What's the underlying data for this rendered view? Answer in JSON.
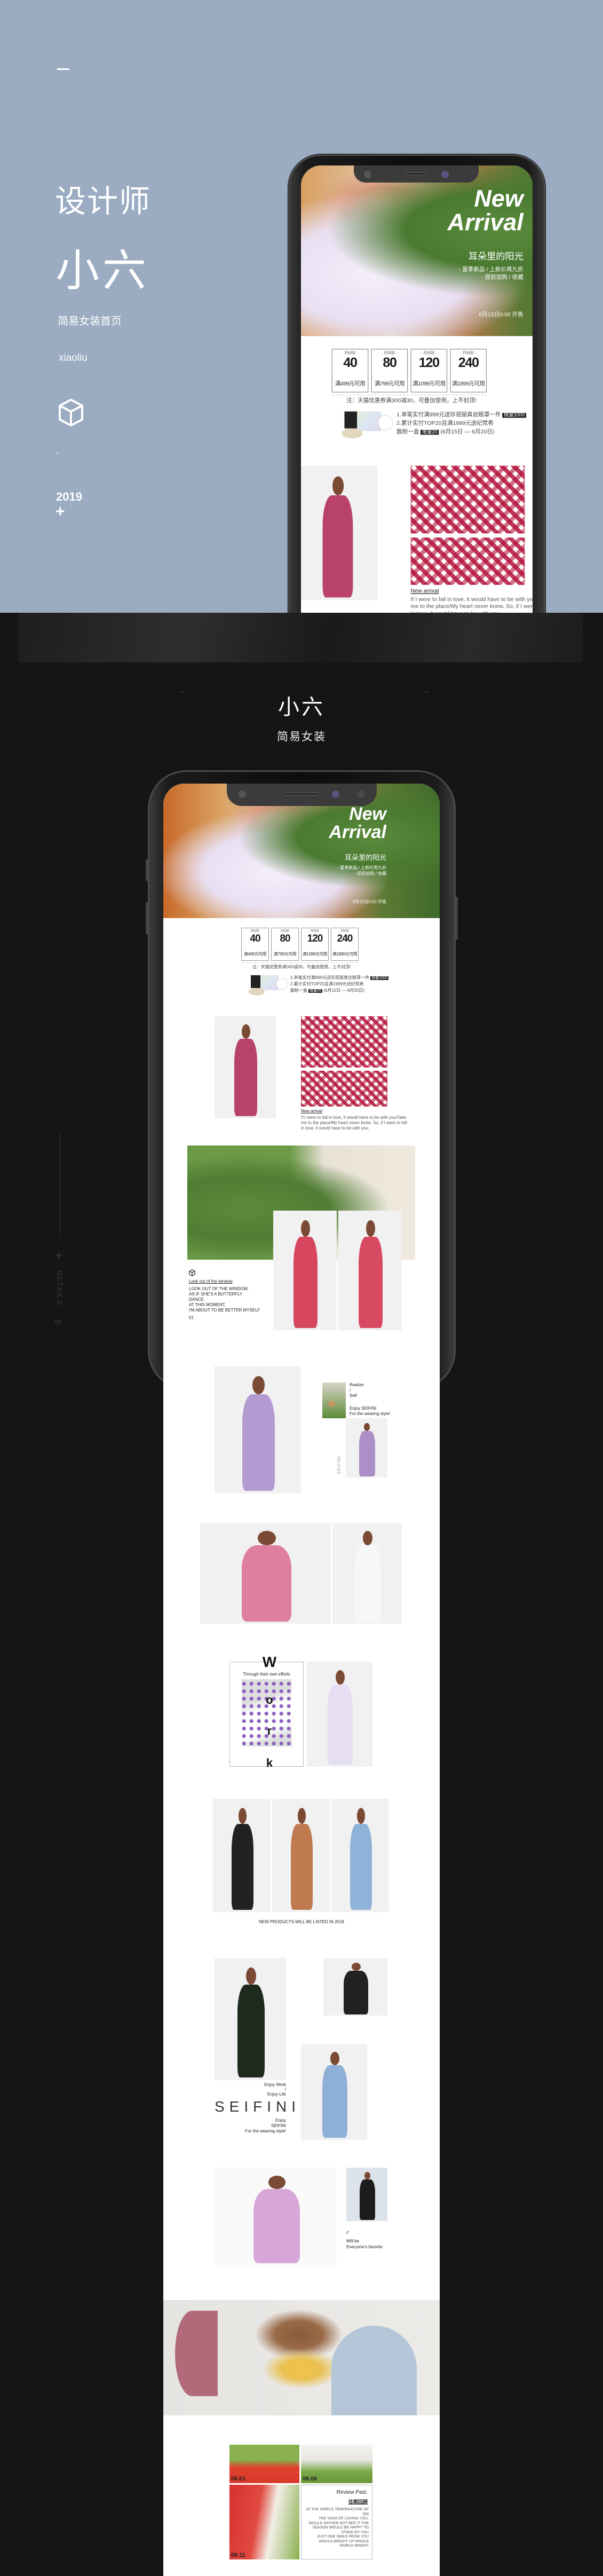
{
  "cover": {
    "dash": "—",
    "title": "设计师",
    "name": "小六",
    "subtitle": "简易女装首页",
    "pinyin": "xiaoliu",
    "cube_icon": "cube-icon",
    "small_dash": "-",
    "year": "2019",
    "plus": "+",
    "background_color": "#9aabc2"
  },
  "showcase": {
    "title": "小六",
    "subtitle": "简易女装",
    "side_plus": "+",
    "side_label": "DETAILS",
    "side_bars": "||",
    "background_color": "#151515"
  },
  "hero": {
    "line1": "New",
    "line2": "Arrival",
    "slogan": "耳朵里的阳光",
    "tag1": "- 夏季新品 / 上新价再九折",
    "tag2": "- 提前加购 / 收藏",
    "date": "6月15日0:00 开售"
  },
  "coupons": {
    "currency": "· RMB ·",
    "items": [
      {
        "value": "40",
        "condition": "满499元可用"
      },
      {
        "value": "80",
        "condition": "满799元可用"
      },
      {
        "value": "120",
        "condition": "满1099元可用"
      },
      {
        "value": "240",
        "condition": "满1899元可用"
      }
    ],
    "note": "注：天猫优惠券满300减30，可叠加使用，上不封顶!"
  },
  "gift": {
    "line1": "1.单笔实付满999元送珍视丽真丝眼罩一件",
    "badge1": "限量1000",
    "line2": "2.累计实付TOP20且满1999元送纪梵希",
    "line3": "散粉一盒",
    "badge2": "限量20",
    "period": "(6月15日 — 6月20日)"
  },
  "product1": {
    "caption": "New arrival",
    "desc": "If I were to fall in love, it would have to be with you/Take me to the place/My heart never knew. So, if I were to fall in love, it would have to be with you."
  },
  "window": {
    "title": "Look out of the window",
    "lines": [
      "LOOK OUT OF THE WINDOW,",
      "AS IF SHE'S A BUTTERFLY",
      "DANCE",
      "AT THIS MOMENT,",
      "I'M ABOUT TO BE BETTER MYSELF"
    ],
    "page": "01"
  },
  "floral": {
    "t1": "Realize",
    "t2": "/",
    "t3": "Self",
    "t4": "Enjoy SEIFINI",
    "t5": "For the wearing style!",
    "vertical": "SEIFINI"
  },
  "work": {
    "letters": [
      "W",
      "o",
      "r",
      "k"
    ],
    "subtitle": "Through their own efforts"
  },
  "trio": {
    "caption": "NEW PRODUCTS WILL BE LISTED IN 2019"
  },
  "brand": {
    "top1": "Enjoy Work",
    "top2": "/",
    "top3": "Enjoy Life",
    "logo": "SEIFINI",
    "bottom1": "Enjoy",
    "bottom2": "SEIFINI",
    "bottom3": "For the wearing style!"
  },
  "fav": {
    "mark": "//",
    "line1": "Will be",
    "line2": "Everyone's favorite"
  },
  "review": {
    "dates": [
      "06.01",
      "06.06",
      "06.11"
    ],
    "title": "Review Past.",
    "subtitle": "往期回顾",
    "text1": "AT THE SIMPLE TEMPERATURE OF 360",
    "text2": "THE YEAR OF LOVING YOU, WOULD RATHER NOT BEE IT THE SEASON WOULD BE HAPPY TO STAND BY YOU",
    "text3": "JUST ONE SMILE FROM YOU WOULD BRIGHT UP WHOLE WORLD BRIGHT"
  }
}
